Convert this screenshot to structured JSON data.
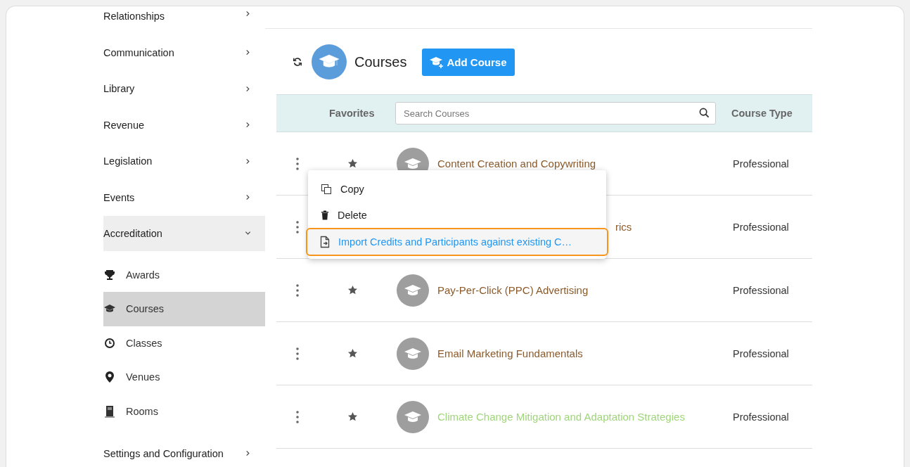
{
  "sidebar": {
    "items": [
      {
        "label": "Relationships",
        "expanded": false,
        "selected": false
      },
      {
        "label": "Communication",
        "expanded": false,
        "selected": false
      },
      {
        "label": "Library",
        "expanded": false,
        "selected": false
      },
      {
        "label": "Revenue",
        "expanded": false,
        "selected": false
      },
      {
        "label": "Legislation",
        "expanded": false,
        "selected": false
      },
      {
        "label": "Events",
        "expanded": false,
        "selected": false
      },
      {
        "label": "Accreditation",
        "expanded": true,
        "selected": false,
        "children": [
          {
            "label": "Awards",
            "selected": false
          },
          {
            "label": "Courses",
            "selected": true
          },
          {
            "label": "Classes",
            "selected": false
          },
          {
            "label": "Venues",
            "selected": false
          },
          {
            "label": "Rooms",
            "selected": false
          }
        ]
      },
      {
        "label": "Settings and Configuration",
        "expanded": false,
        "selected": false
      }
    ]
  },
  "header": {
    "title": "Courses",
    "add_button": "Add Course"
  },
  "table": {
    "columns": {
      "favorites": "Favorites",
      "search_placeholder": "Search Courses",
      "course_type": "Course Type"
    },
    "rows": [
      {
        "kind": "full",
        "title": "Content Creation and Copywriting",
        "color": "#8b5a2b",
        "type": "Professional"
      },
      {
        "kind": "covered",
        "title": "rics",
        "color": "#8b5a2b",
        "type": "Professional"
      },
      {
        "kind": "full",
        "title": "Pay-Per-Click (PPC) Advertising",
        "color": "#8b5a2b",
        "type": "Professional"
      },
      {
        "kind": "full",
        "title": "Email Marketing Fundamentals",
        "color": "#8b5a2b",
        "type": "Professional"
      },
      {
        "kind": "full",
        "title": "Climate Change Mitigation and Adaptation Strategies",
        "color": "#9fd67a",
        "type": "Professional"
      }
    ]
  },
  "context_menu": {
    "items": [
      {
        "label": "Copy",
        "selected": false
      },
      {
        "label": "Delete",
        "selected": false
      },
      {
        "label": "Import Credits and Participants against existing C…",
        "selected": true
      }
    ]
  }
}
